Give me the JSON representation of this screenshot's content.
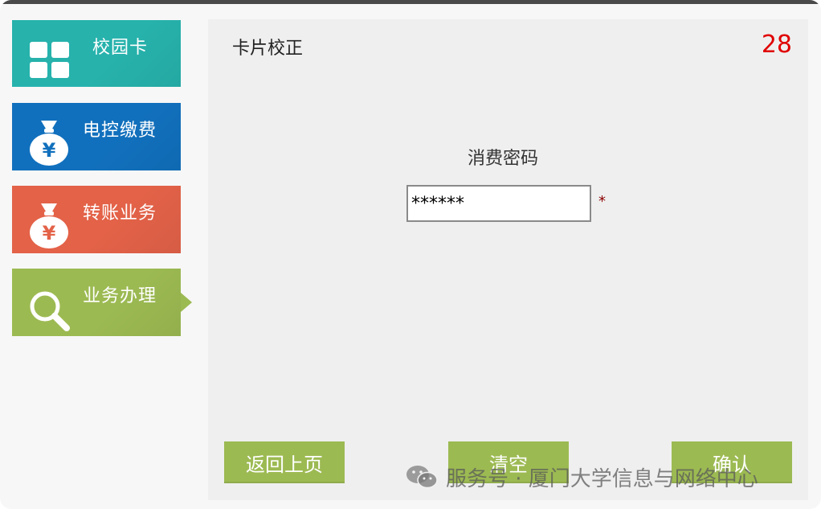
{
  "sidebar": {
    "items": [
      {
        "label": "校园卡",
        "icon": "grid-icon",
        "color": "#27b2ac"
      },
      {
        "label": "电控缴费",
        "icon": "money-bag-icon",
        "color": "#1170bd"
      },
      {
        "label": "转账业务",
        "icon": "money-bag-icon",
        "color": "#e36248"
      },
      {
        "label": "业务办理",
        "icon": "search-icon",
        "color": "#9cba52",
        "active": true
      }
    ]
  },
  "main": {
    "title": "卡片校正",
    "countdown": "28",
    "field_label": "消费密码",
    "password_value": "******",
    "required_mark": "*",
    "buttons": {
      "back": "返回上页",
      "clear": "清空",
      "confirm": "确认"
    }
  },
  "watermark": {
    "icon": "wechat-icon",
    "text": "服务号 · 厦门大学信息与网络中心"
  }
}
